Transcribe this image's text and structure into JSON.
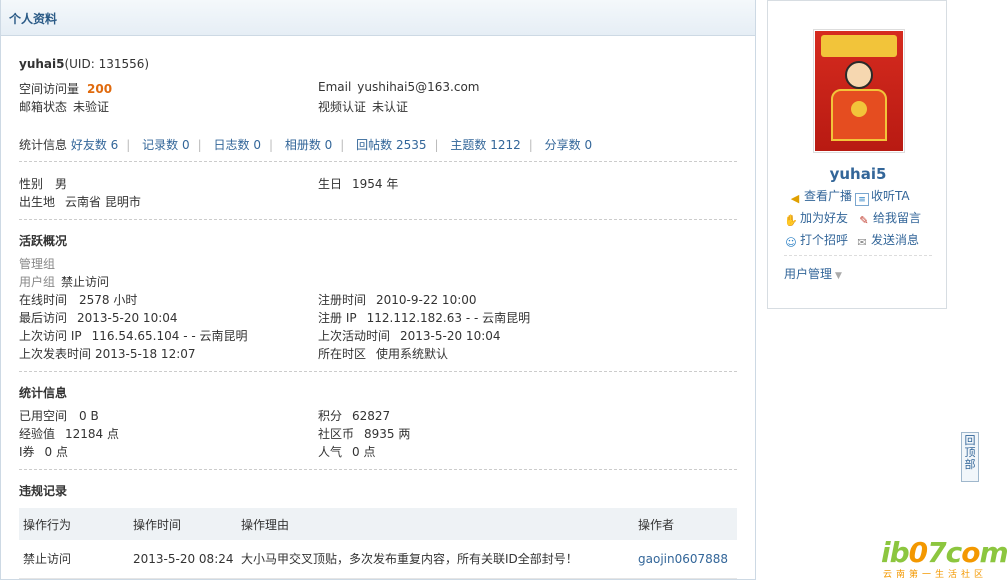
{
  "header": {
    "title": "个人资料"
  },
  "profile": {
    "username": "yuhai5",
    "uid": "(UID: 131556)",
    "visits_label": "空间访问量",
    "visits_value": "200",
    "email_label": "Email",
    "email_value": "yushihai5@163.com",
    "mail_status_label": "邮箱状态",
    "mail_status_value": "未验证",
    "video_label": "视频认证",
    "video_value": "未认证"
  },
  "stats_bar": {
    "label": "统计信息",
    "items": [
      "好友数 6",
      "记录数 0",
      "日志数 0",
      "相册数 0",
      "回帖数 2535",
      "主题数 1212",
      "分享数 0"
    ]
  },
  "personal": {
    "gender_label": "性别",
    "gender_value": "男",
    "birthday_label": "生日",
    "birthday_value": "1954 年",
    "birthplace_label": "出生地",
    "birthplace_value": "云南省 昆明市"
  },
  "activity": {
    "title": "活跃概况",
    "admin_group_label": "管理组",
    "user_group_label": "用户组",
    "user_group_value": "禁止访问",
    "online_label": "在线时间",
    "online_value": "2578 小时",
    "register_time_label": "注册时间",
    "register_time_value": "2010-9-22 10:00",
    "last_visit_label": "最后访问",
    "last_visit_value": "2013-5-20 10:04",
    "register_ip_label": "注册 IP",
    "register_ip_value": "112.112.182.63 - - 云南昆明",
    "last_ip_label": "上次访问 IP",
    "last_ip_value": "116.54.65.104 - - 云南昆明",
    "last_active_label": "上次活动时间",
    "last_active_value": "2013-5-20 10:04",
    "last_post_label": "上次发表时间",
    "last_post_value": "2013-5-18 12:07",
    "timezone_label": "所在时区",
    "timezone_value": "使用系统默认"
  },
  "statistics": {
    "title": "统计信息",
    "space_label": "已用空间",
    "space_value": "0 B",
    "points_label": "积分",
    "points_value": "62827",
    "exp_label": "经验值",
    "exp_value": "12184 点",
    "coins_label": "社区币",
    "coins_value": "8935 两",
    "ticket_label": "I券",
    "ticket_value": "0 点",
    "popularity_label": "人气",
    "popularity_value": "0 点"
  },
  "violations": {
    "title": "违规记录",
    "columns": [
      "操作行为",
      "操作时间",
      "操作理由",
      "操作者"
    ],
    "rows": [
      [
        "禁止访问",
        "2013-5-20 08:24",
        "大小马甲交叉顶贴，多次发布重复内容，所有关联ID全部封号！",
        "gaojin0607888"
      ]
    ]
  },
  "sidebar": {
    "username": "yuhai5",
    "actions": [
      "查看广播",
      "收听TA",
      "加为好友",
      "给我留言",
      "打个招呼",
      "发送消息"
    ],
    "manage_label": "用户管理",
    "icons": [
      "broadcast-icon",
      "listen-icon",
      "add-friend-icon",
      "message-icon",
      "greet-icon",
      "send-message-icon"
    ]
  },
  "back_to_top": "回顶部",
  "watermark": {
    "text": "ib07com",
    "sub": "云南第一生活社区"
  },
  "colors": {
    "accent": "#336699",
    "orange": "#e06a0d",
    "header_bg": "#e6eef5"
  }
}
